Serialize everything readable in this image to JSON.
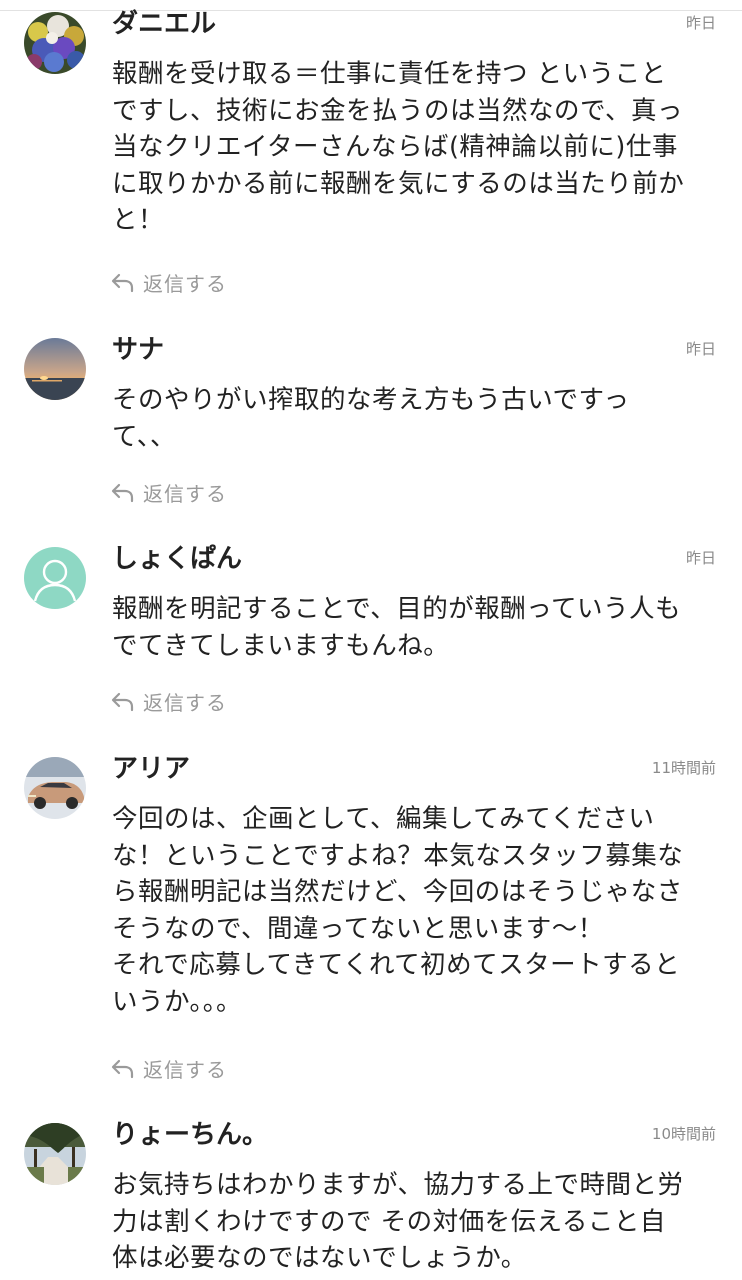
{
  "reply_label": "返信する",
  "icons": {
    "reply": "reply-arrow-icon",
    "default_avatar": "person-icon"
  },
  "colors": {
    "text": "#222222",
    "muted": "#9a9a9a",
    "default_avatar_bg": "#8ed8c4"
  },
  "comments": [
    {
      "name": "ダニエル",
      "time": "昨日",
      "avatar": "flower-bouquet-photo",
      "text": "報酬を受け取る＝仕事に責任を持つ ということ\nですし、技術にお金を払うのは当然なので、真っ\n当なクリエイターさんならば(精神論以前に)仕事\nに取りかかる前に報酬を気にするのは当たり前か\nと！"
    },
    {
      "name": "サナ",
      "time": "昨日",
      "avatar": "sunset-sea-photo",
      "text": "そのやりがい搾取的な考え方もう古いですっ\nて、、"
    },
    {
      "name": "しょくぱん",
      "time": "昨日",
      "avatar": "default-person-avatar",
      "text": "報酬を明記することで、目的が報酬っていう人も\nでてきてしまいますもんね。"
    },
    {
      "name": "アリア",
      "time": "11時間前",
      "avatar": "car-photo",
      "text": "今回のは、企画として、編集してみてください\nな！ということですよね？本気なスタッフ募集な\nら報酬明記は当然だけど、今回のはそうじゃなさ\nそうなので、間違ってないと思います〜！\nそれで応募してきてくれて初めてスタートすると\nいうか。。。"
    },
    {
      "name": "りょーちん。",
      "time": "10時間前",
      "avatar": "tree-path-photo",
      "text": "お気持ちはわかりますが、協力する上で時間と労\n力は割くわけですので その対価を伝えること自\n体は必要なのではないでしょうか。"
    }
  ]
}
